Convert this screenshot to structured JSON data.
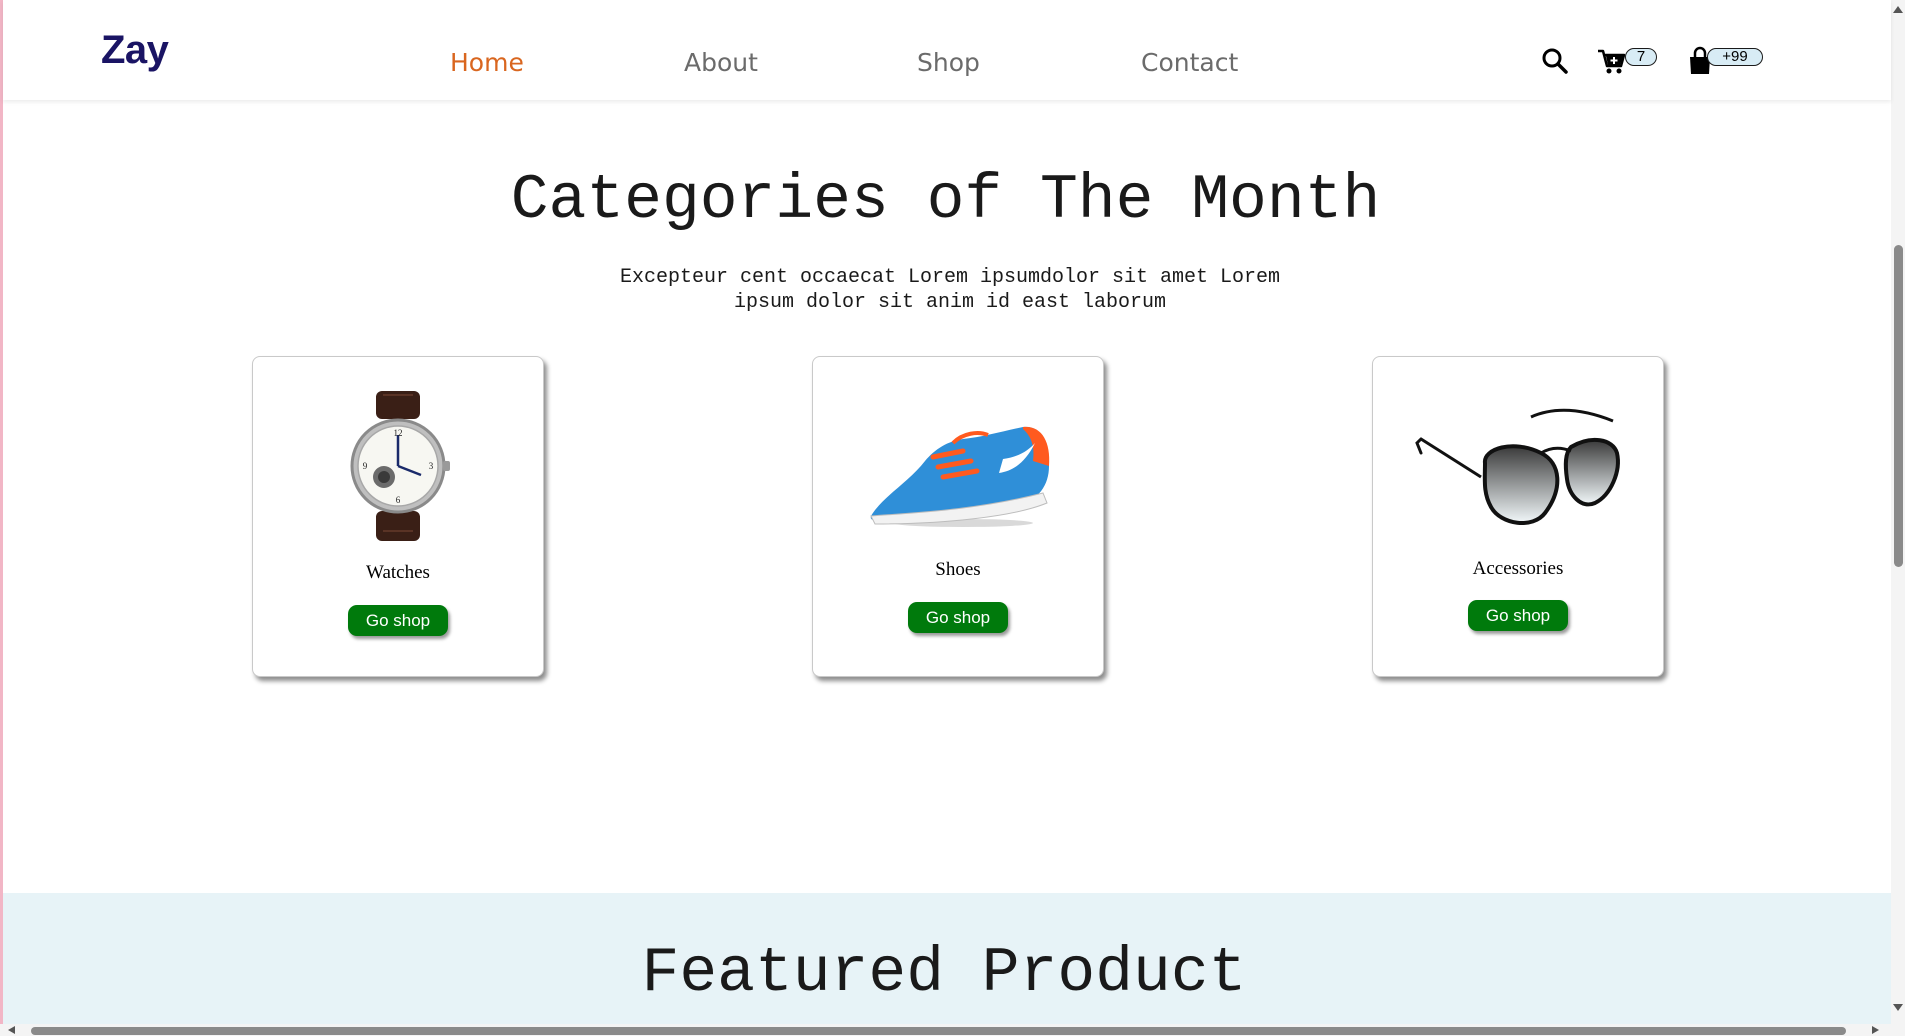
{
  "header": {
    "logo": "Zay",
    "nav": {
      "home": "Home",
      "about": "About",
      "shop": "Shop",
      "contact": "Contact"
    },
    "active_nav": "Home",
    "cart_count": "7",
    "bag_count": "+99",
    "icons": [
      "search-icon",
      "cart-plus-icon",
      "shopping-bag-icon"
    ]
  },
  "categories": {
    "title": "Categories of The Month",
    "description_line1": "Excepteur cent occaecat Lorem ipsumdolor sit amet Lorem",
    "description_line2": "ipsum dolor sit anim id east laborum",
    "items": [
      {
        "label": "Watches",
        "button": "Go shop",
        "icon": "watch-image"
      },
      {
        "label": "Shoes",
        "button": "Go shop",
        "icon": "sneaker-image"
      },
      {
        "label": "Accessories",
        "button": "Go shop",
        "icon": "sunglasses-image"
      }
    ]
  },
  "featured": {
    "title": "Featured Product"
  },
  "colors": {
    "logo": "#1a1464",
    "nav_active": "#d9661f",
    "nav_default": "#6b6b6b",
    "button": "#007a0c",
    "featured_bg": "#e7f3f7",
    "badge_bg": "#d8ecf5"
  }
}
